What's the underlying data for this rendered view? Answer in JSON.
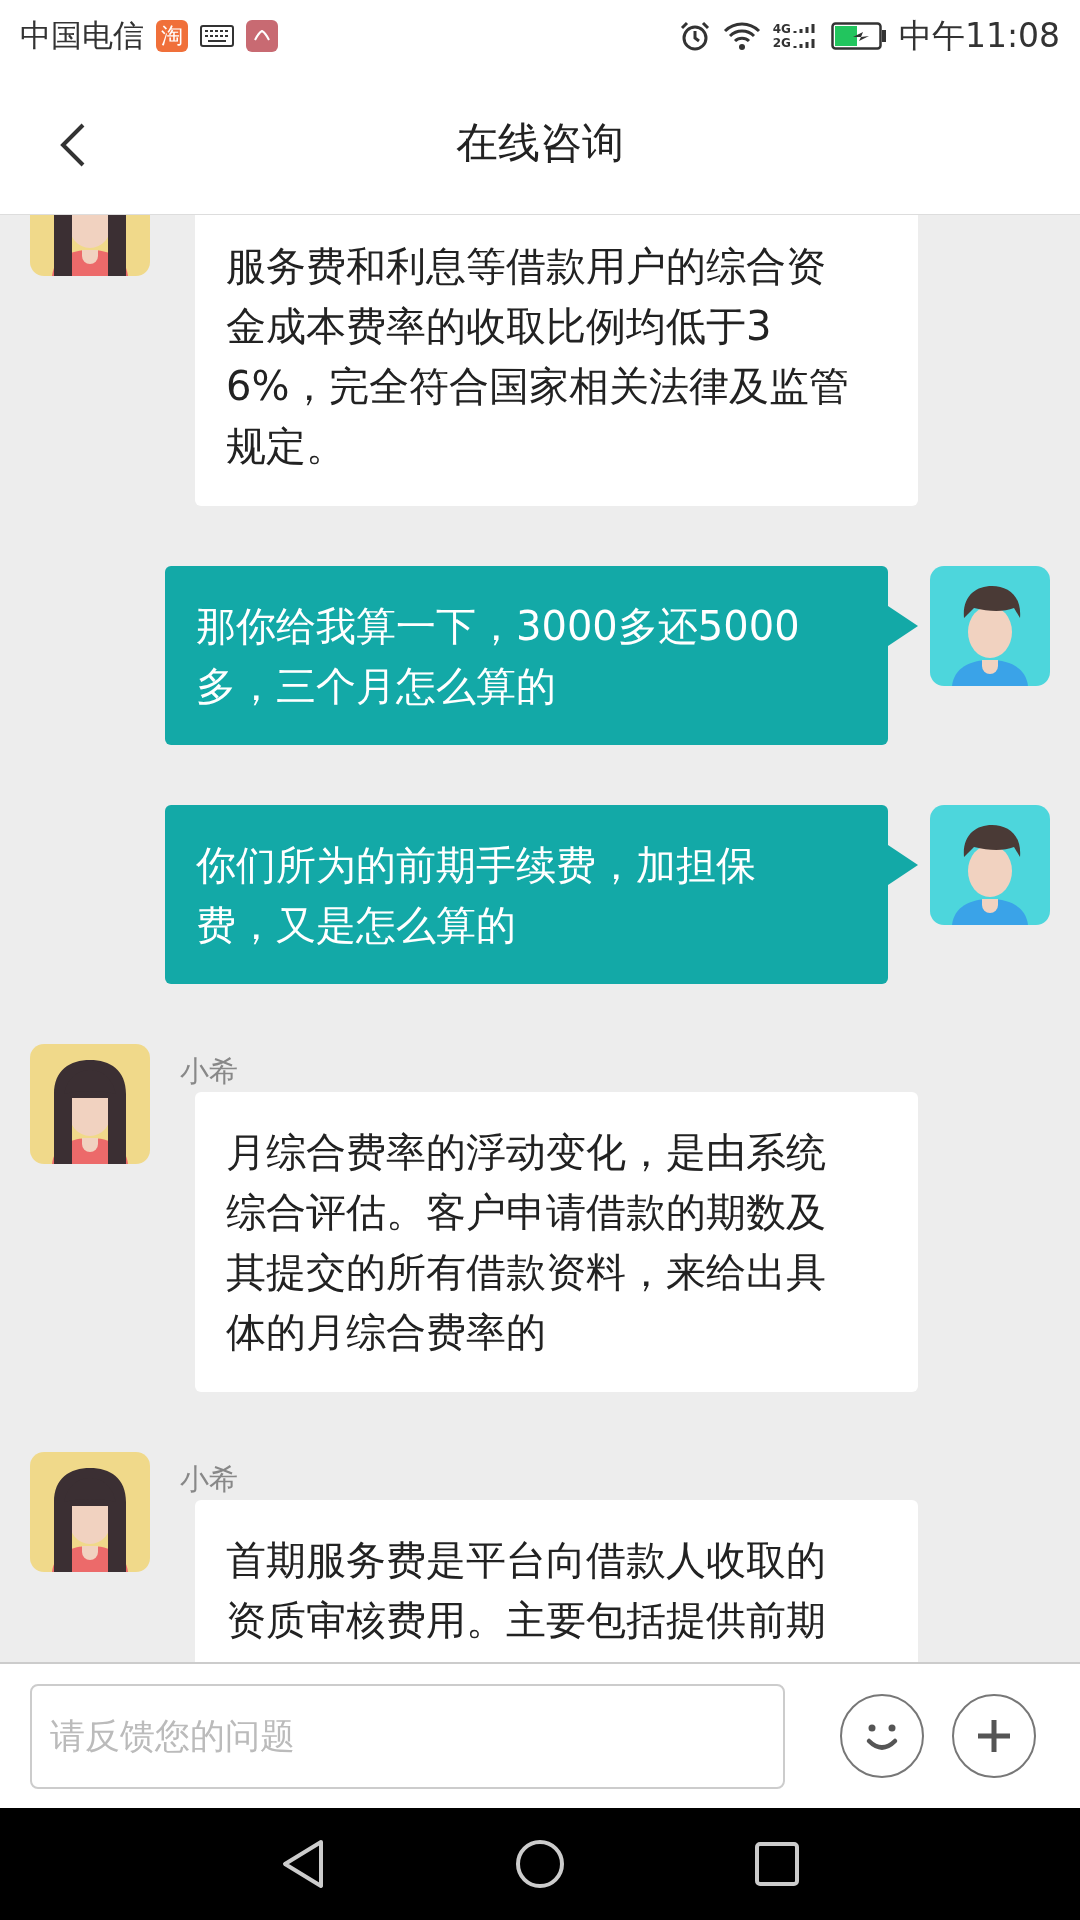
{
  "status_bar": {
    "carrier": "中国电信",
    "app_badge": "淘",
    "network_labels": [
      "4G",
      "2G"
    ],
    "time": "中午11:08"
  },
  "header": {
    "title": "在线咨询"
  },
  "messages": [
    {
      "kind": "agent",
      "text": "服务费和利息等借款用户的综合资金成本费率的收取比例均低于36%，完全符合国家相关法律及监管规定。"
    },
    {
      "kind": "user",
      "text": "那你给我算一下，3000多还5000多，三个月怎么算的"
    },
    {
      "kind": "user",
      "text": "你们所为的前期手续费，加担保费，又是怎么算的"
    },
    {
      "kind": "agent",
      "name": "小希",
      "text": "月综合费率的浮动变化，是由系统综合评估。客户申请借款的期数及其提交的所有借款资料，来给出具体的月综合费率的"
    },
    {
      "kind": "agent",
      "name": "小希",
      "text": "首期服务费是平台向借款人收取的资质审核费用。主要包括提供前期"
    }
  ],
  "input": {
    "placeholder": "请反馈您的问题"
  }
}
